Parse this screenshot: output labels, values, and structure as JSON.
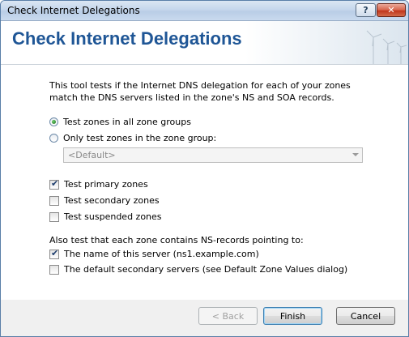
{
  "window": {
    "title": "Check Internet Delegations",
    "help_label": "?",
    "close_label": "✕"
  },
  "header": {
    "title": "Check Internet Delegations",
    "graphic": "wind-turbines-image"
  },
  "description": "This tool tests if the Internet DNS delegation for each of your zones match the DNS servers listed in the zone's NS and SOA records.",
  "scope": {
    "options": [
      {
        "label": "Test zones in all zone groups",
        "checked": true
      },
      {
        "label": "Only test zones in the zone group:",
        "checked": false
      }
    ],
    "zone_group": {
      "value": "<Default>",
      "enabled": false
    }
  },
  "zone_types": [
    {
      "label": "Test primary zones",
      "checked": true
    },
    {
      "label": "Test secondary zones",
      "checked": false
    },
    {
      "label": "Test suspended zones",
      "checked": false
    }
  ],
  "ns_records": {
    "heading": "Also test that each zone contains NS-records pointing to:",
    "options": [
      {
        "label": "The name of this server (ns1.example.com)",
        "checked": true
      },
      {
        "label": "The default secondary servers (see Default Zone Values dialog)",
        "checked": false
      }
    ]
  },
  "buttons": {
    "back": "< Back",
    "finish": "Finish",
    "cancel": "Cancel"
  }
}
